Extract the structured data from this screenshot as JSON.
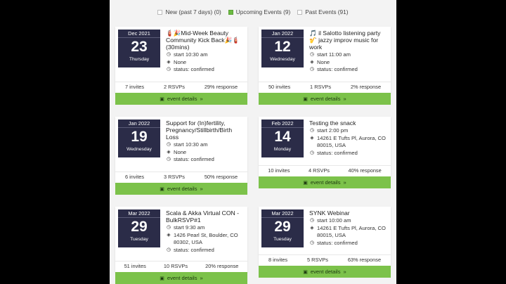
{
  "filters": [
    {
      "label": "New (past 7 days) (0)",
      "checked": false
    },
    {
      "label": "Upcoming Events (9)",
      "checked": true
    },
    {
      "label": "Past Events (91)",
      "checked": false
    }
  ],
  "details_label": "event details",
  "events": [
    {
      "month": "Dec 2021",
      "day": "23",
      "weekday": "Thursday",
      "title": "🧯🎉Mid-Week Beauty Community Kick Back🎉🧯(30mins)",
      "time": "start 10:30 am",
      "location": "None",
      "status": "status: confirmed",
      "invites": "7 invites",
      "rsvps": "2 RSVPs",
      "response": "29% response"
    },
    {
      "month": "Jan 2022",
      "day": "12",
      "weekday": "Wednesday",
      "title": "🎵 il Salotto listening party 🎷 jazzy improv music for work",
      "time": "start 11:00 am",
      "location": "None",
      "status": "status: confirmed",
      "invites": "50 invites",
      "rsvps": "1 RSVPs",
      "response": "2% response"
    },
    {
      "month": "Jan 2022",
      "day": "19",
      "weekday": "Wednesday",
      "title": "Support for (In)fertility, Pregnancy/Stillbirth/Birth Loss",
      "time": "start 10:30 am",
      "location": "None",
      "status": "status: confirmed",
      "invites": "6 invites",
      "rsvps": "3 RSVPs",
      "response": "50% response"
    },
    {
      "month": "Feb 2022",
      "day": "14",
      "weekday": "Monday",
      "title": "Testing the snack",
      "time": "start 2:00 pm",
      "location": "14261 E Tufts Pl, Aurora, CO 80015, USA",
      "status": "status: confirmed",
      "invites": "10 invites",
      "rsvps": "4 RSVPs",
      "response": "40% response"
    },
    {
      "month": "Mar 2022",
      "day": "29",
      "weekday": "Tuesday",
      "title": "Scala & Akka Virtual CON - BulkRSVP#1",
      "time": "start 9:30 am",
      "location": "1426 Pearl St, Boulder, CO 80302, USA",
      "status": "status: confirmed",
      "invites": "51 invites",
      "rsvps": "10 RSVPs",
      "response": "20% response"
    },
    {
      "month": "Mar 2022",
      "day": "29",
      "weekday": "Tuesday",
      "title": "SYNK Webinar",
      "time": "start 10:00 am",
      "location": "14261 E Tufts Pl, Aurora, CO 80015, USA",
      "status": "status: confirmed",
      "invites": "8 invites",
      "rsvps": "5 RSVPs",
      "response": "63% response"
    }
  ]
}
